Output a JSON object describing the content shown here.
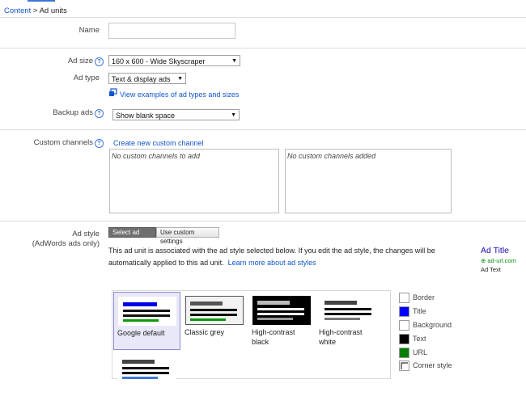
{
  "breadcrumb": {
    "parent": "Content",
    "separator": " > ",
    "current": "Ad units"
  },
  "form": {
    "name_label": "Name",
    "name_value": "",
    "ad_size_label": "Ad size",
    "ad_size_value": "160 x 600 - Wide Skyscraper",
    "ad_type_label": "Ad type",
    "ad_type_value": "Text & display ads",
    "view_examples_link": "View examples of ad types and sizes",
    "backup_ads_label": "Backup ads",
    "backup_ads_value": "Show blank space"
  },
  "channels": {
    "label": "Custom channels",
    "create_link": "Create new custom channel",
    "available_empty": "No custom channels to add",
    "added_empty": "No custom channels added"
  },
  "ad_style": {
    "label_line1": "Ad style",
    "label_line2": "(AdWords ads only)",
    "tab_select": "Select ad style",
    "tab_custom": "Use custom settings",
    "description_line1": "This ad unit is associated with the ad style selected below. If you edit the ad style, the changes will be",
    "description_line2": "automatically applied to this ad unit.",
    "learn_more_link": "Learn more about ad styles",
    "preview": {
      "title": "Ad Title",
      "url": "ad-url.com",
      "text": "Ad Text"
    },
    "styles": [
      {
        "line1": "Google default",
        "line2": ""
      },
      {
        "line1": "Classic grey",
        "line2": ""
      },
      {
        "line1": "High-contrast",
        "line2": "black"
      },
      {
        "line1": "High-contrast",
        "line2": "white"
      }
    ],
    "colors": [
      {
        "label": "Border",
        "color": "#ffffff"
      },
      {
        "label": "Title",
        "color": "#0000ff"
      },
      {
        "label": "Background",
        "color": "#ffffff"
      },
      {
        "label": "Text",
        "color": "#000000"
      },
      {
        "label": "URL",
        "color": "#008000"
      },
      {
        "label": "Corner style",
        "color": "#ffffff"
      }
    ]
  }
}
